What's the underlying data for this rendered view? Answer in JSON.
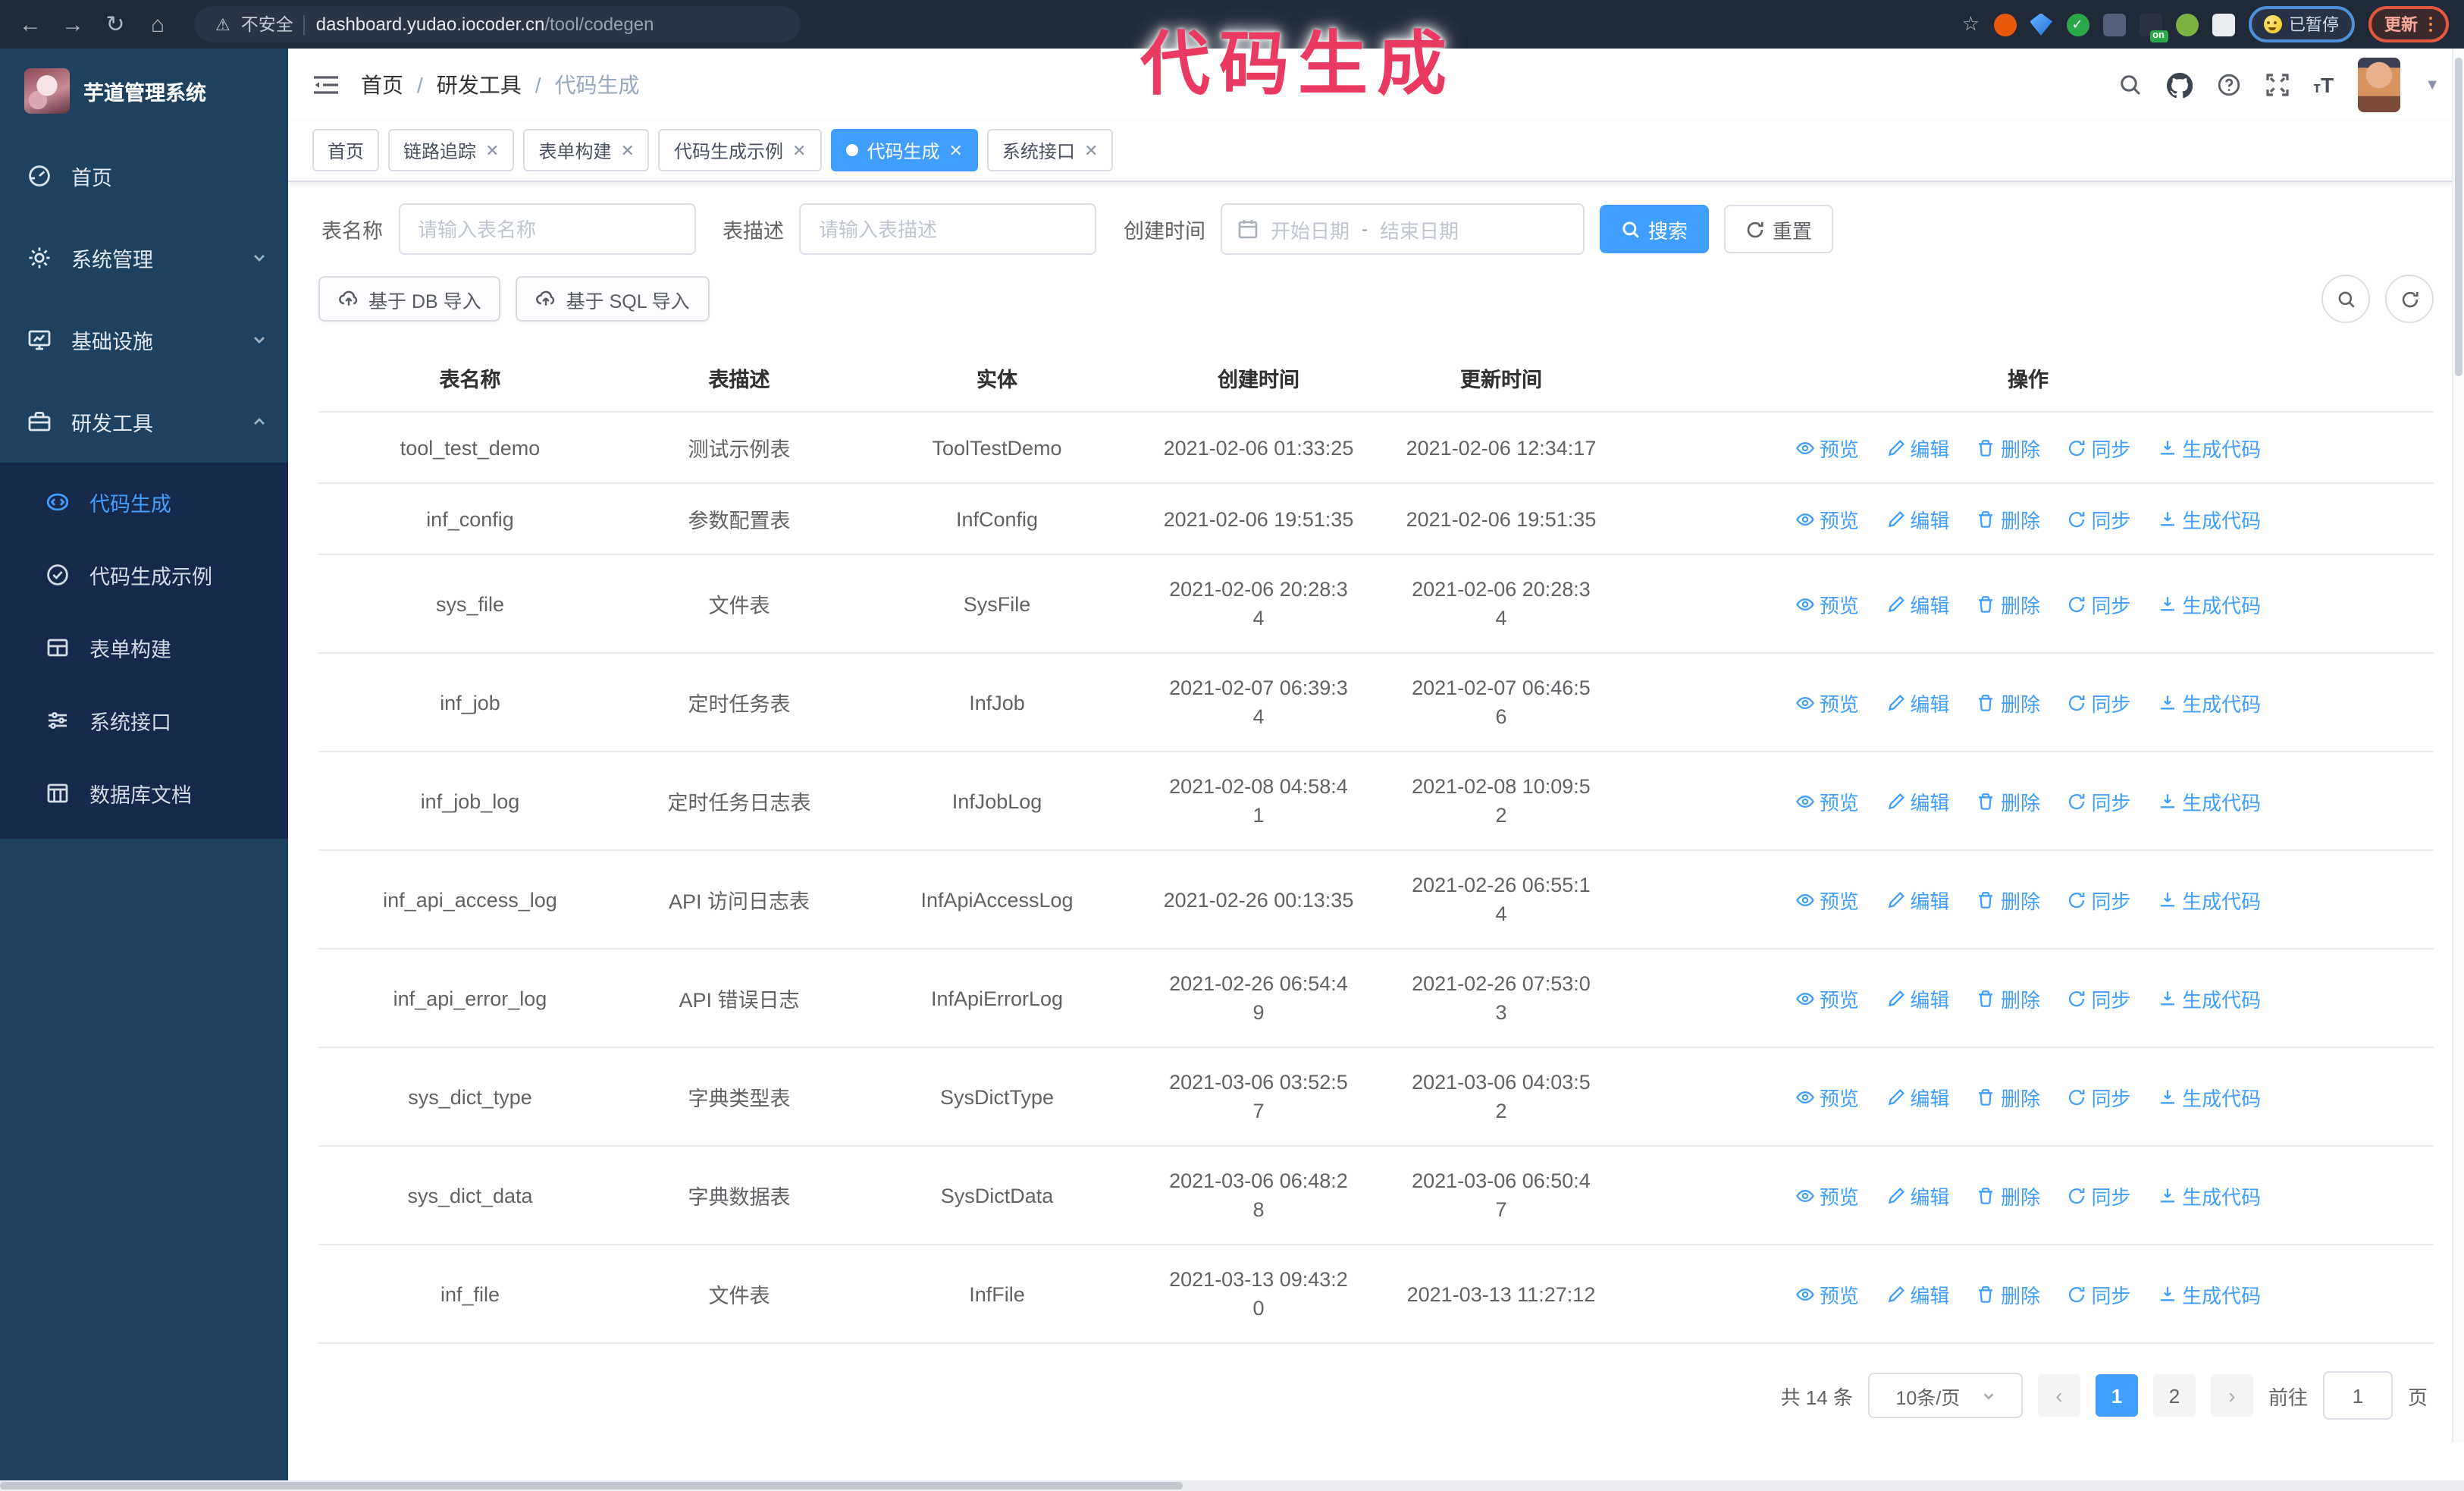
{
  "browser": {
    "security_label": "不安全",
    "url_host": "dashboard.yudao.iocoder.cn",
    "url_path": "/tool/codegen",
    "ext_on_badge": "on",
    "paused_badge": "已暂停",
    "update_button": "更新"
  },
  "annotation": {
    "text": "代码生成",
    "color": "#ea3a62"
  },
  "sidebar": {
    "logo_title": "芋道管理系统",
    "items": [
      {
        "label": "首页"
      },
      {
        "label": "系统管理"
      },
      {
        "label": "基础设施"
      },
      {
        "label": "研发工具"
      }
    ],
    "sub_items": [
      {
        "label": "代码生成",
        "active": true
      },
      {
        "label": "代码生成示例"
      },
      {
        "label": "表单构建"
      },
      {
        "label": "系统接口"
      },
      {
        "label": "数据库文档"
      }
    ]
  },
  "header": {
    "breadcrumb": [
      "首页",
      "研发工具",
      "代码生成"
    ]
  },
  "tabs": [
    {
      "label": "首页"
    },
    {
      "label": "链路追踪"
    },
    {
      "label": "表单构建"
    },
    {
      "label": "代码生成示例"
    },
    {
      "label": "代码生成"
    },
    {
      "label": "系统接口"
    }
  ],
  "filters": {
    "table_name_label": "表名称",
    "table_name_placeholder": "请输入表名称",
    "table_desc_label": "表描述",
    "table_desc_placeholder": "请输入表描述",
    "create_time_label": "创建时间",
    "start_date_placeholder": "开始日期",
    "range_separator": "-",
    "end_date_placeholder": "结束日期",
    "search_label": "搜索",
    "reset_label": "重置"
  },
  "toolbar": {
    "import_db_label": "基于 DB 导入",
    "import_sql_label": "基于 SQL 导入"
  },
  "table": {
    "columns": [
      "表名称",
      "表描述",
      "实体",
      "创建时间",
      "更新时间",
      "操作"
    ],
    "actions": [
      "预览",
      "编辑",
      "删除",
      "同步",
      "生成代码"
    ],
    "rows": [
      {
        "name": "tool_test_demo",
        "desc": "测试示例表",
        "entity": "ToolTestDemo",
        "created": "2021-02-06 01:33:25",
        "updated": "2021-02-06 12:34:17"
      },
      {
        "name": "inf_config",
        "desc": "参数配置表",
        "entity": "InfConfig",
        "created": "2021-02-06 19:51:35",
        "updated": "2021-02-06 19:51:35"
      },
      {
        "name": "sys_file",
        "desc": "文件表",
        "entity": "SysFile",
        "created": "2021-02-06 20:28:3\n4",
        "updated": "2021-02-06 20:28:3\n4"
      },
      {
        "name": "inf_job",
        "desc": "定时任务表",
        "entity": "InfJob",
        "created": "2021-02-07 06:39:3\n4",
        "updated": "2021-02-07 06:46:5\n6"
      },
      {
        "name": "inf_job_log",
        "desc": "定时任务日志表",
        "entity": "InfJobLog",
        "created": "2021-02-08 04:58:4\n1",
        "updated": "2021-02-08 10:09:5\n2"
      },
      {
        "name": "inf_api_access_log",
        "desc": "API 访问日志表",
        "entity": "InfApiAccessLog",
        "created": "2021-02-26 00:13:35",
        "updated": "2021-02-26 06:55:1\n4"
      },
      {
        "name": "inf_api_error_log",
        "desc": "API 错误日志",
        "entity": "InfApiErrorLog",
        "created": "2021-02-26 06:54:4\n9",
        "updated": "2021-02-26 07:53:0\n3"
      },
      {
        "name": "sys_dict_type",
        "desc": "字典类型表",
        "entity": "SysDictType",
        "created": "2021-03-06 03:52:5\n7",
        "updated": "2021-03-06 04:03:5\n2"
      },
      {
        "name": "sys_dict_data",
        "desc": "字典数据表",
        "entity": "SysDictData",
        "created": "2021-03-06 06:48:2\n8",
        "updated": "2021-03-06 06:50:4\n7"
      },
      {
        "name": "inf_file",
        "desc": "文件表",
        "entity": "InfFile",
        "created": "2021-03-13 09:43:2\n0",
        "updated": "2021-03-13 11:27:12"
      }
    ]
  },
  "pagination": {
    "total_label": "共 14 条",
    "page_size": "10条/页",
    "pages": [
      "1",
      "2"
    ],
    "goto_label": "前往",
    "goto_value": "1",
    "page_suffix": "页"
  }
}
